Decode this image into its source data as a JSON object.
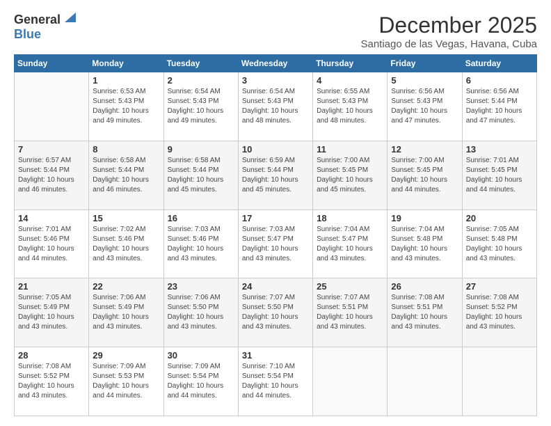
{
  "logo": {
    "general": "General",
    "blue": "Blue"
  },
  "title": "December 2025",
  "location": "Santiago de las Vegas, Havana, Cuba",
  "days_header": [
    "Sunday",
    "Monday",
    "Tuesday",
    "Wednesday",
    "Thursday",
    "Friday",
    "Saturday"
  ],
  "weeks": [
    [
      {
        "day": "",
        "info": ""
      },
      {
        "day": "1",
        "info": "Sunrise: 6:53 AM\nSunset: 5:43 PM\nDaylight: 10 hours\nand 49 minutes."
      },
      {
        "day": "2",
        "info": "Sunrise: 6:54 AM\nSunset: 5:43 PM\nDaylight: 10 hours\nand 49 minutes."
      },
      {
        "day": "3",
        "info": "Sunrise: 6:54 AM\nSunset: 5:43 PM\nDaylight: 10 hours\nand 48 minutes."
      },
      {
        "day": "4",
        "info": "Sunrise: 6:55 AM\nSunset: 5:43 PM\nDaylight: 10 hours\nand 48 minutes."
      },
      {
        "day": "5",
        "info": "Sunrise: 6:56 AM\nSunset: 5:43 PM\nDaylight: 10 hours\nand 47 minutes."
      },
      {
        "day": "6",
        "info": "Sunrise: 6:56 AM\nSunset: 5:44 PM\nDaylight: 10 hours\nand 47 minutes."
      }
    ],
    [
      {
        "day": "7",
        "info": "Sunrise: 6:57 AM\nSunset: 5:44 PM\nDaylight: 10 hours\nand 46 minutes."
      },
      {
        "day": "8",
        "info": "Sunrise: 6:58 AM\nSunset: 5:44 PM\nDaylight: 10 hours\nand 46 minutes."
      },
      {
        "day": "9",
        "info": "Sunrise: 6:58 AM\nSunset: 5:44 PM\nDaylight: 10 hours\nand 45 minutes."
      },
      {
        "day": "10",
        "info": "Sunrise: 6:59 AM\nSunset: 5:44 PM\nDaylight: 10 hours\nand 45 minutes."
      },
      {
        "day": "11",
        "info": "Sunrise: 7:00 AM\nSunset: 5:45 PM\nDaylight: 10 hours\nand 45 minutes."
      },
      {
        "day": "12",
        "info": "Sunrise: 7:00 AM\nSunset: 5:45 PM\nDaylight: 10 hours\nand 44 minutes."
      },
      {
        "day": "13",
        "info": "Sunrise: 7:01 AM\nSunset: 5:45 PM\nDaylight: 10 hours\nand 44 minutes."
      }
    ],
    [
      {
        "day": "14",
        "info": "Sunrise: 7:01 AM\nSunset: 5:46 PM\nDaylight: 10 hours\nand 44 minutes."
      },
      {
        "day": "15",
        "info": "Sunrise: 7:02 AM\nSunset: 5:46 PM\nDaylight: 10 hours\nand 43 minutes."
      },
      {
        "day": "16",
        "info": "Sunrise: 7:03 AM\nSunset: 5:46 PM\nDaylight: 10 hours\nand 43 minutes."
      },
      {
        "day": "17",
        "info": "Sunrise: 7:03 AM\nSunset: 5:47 PM\nDaylight: 10 hours\nand 43 minutes."
      },
      {
        "day": "18",
        "info": "Sunrise: 7:04 AM\nSunset: 5:47 PM\nDaylight: 10 hours\nand 43 minutes."
      },
      {
        "day": "19",
        "info": "Sunrise: 7:04 AM\nSunset: 5:48 PM\nDaylight: 10 hours\nand 43 minutes."
      },
      {
        "day": "20",
        "info": "Sunrise: 7:05 AM\nSunset: 5:48 PM\nDaylight: 10 hours\nand 43 minutes."
      }
    ],
    [
      {
        "day": "21",
        "info": "Sunrise: 7:05 AM\nSunset: 5:49 PM\nDaylight: 10 hours\nand 43 minutes."
      },
      {
        "day": "22",
        "info": "Sunrise: 7:06 AM\nSunset: 5:49 PM\nDaylight: 10 hours\nand 43 minutes."
      },
      {
        "day": "23",
        "info": "Sunrise: 7:06 AM\nSunset: 5:50 PM\nDaylight: 10 hours\nand 43 minutes."
      },
      {
        "day": "24",
        "info": "Sunrise: 7:07 AM\nSunset: 5:50 PM\nDaylight: 10 hours\nand 43 minutes."
      },
      {
        "day": "25",
        "info": "Sunrise: 7:07 AM\nSunset: 5:51 PM\nDaylight: 10 hours\nand 43 minutes."
      },
      {
        "day": "26",
        "info": "Sunrise: 7:08 AM\nSunset: 5:51 PM\nDaylight: 10 hours\nand 43 minutes."
      },
      {
        "day": "27",
        "info": "Sunrise: 7:08 AM\nSunset: 5:52 PM\nDaylight: 10 hours\nand 43 minutes."
      }
    ],
    [
      {
        "day": "28",
        "info": "Sunrise: 7:08 AM\nSunset: 5:52 PM\nDaylight: 10 hours\nand 43 minutes."
      },
      {
        "day": "29",
        "info": "Sunrise: 7:09 AM\nSunset: 5:53 PM\nDaylight: 10 hours\nand 44 minutes."
      },
      {
        "day": "30",
        "info": "Sunrise: 7:09 AM\nSunset: 5:54 PM\nDaylight: 10 hours\nand 44 minutes."
      },
      {
        "day": "31",
        "info": "Sunrise: 7:10 AM\nSunset: 5:54 PM\nDaylight: 10 hours\nand 44 minutes."
      },
      {
        "day": "",
        "info": ""
      },
      {
        "day": "",
        "info": ""
      },
      {
        "day": "",
        "info": ""
      }
    ]
  ]
}
